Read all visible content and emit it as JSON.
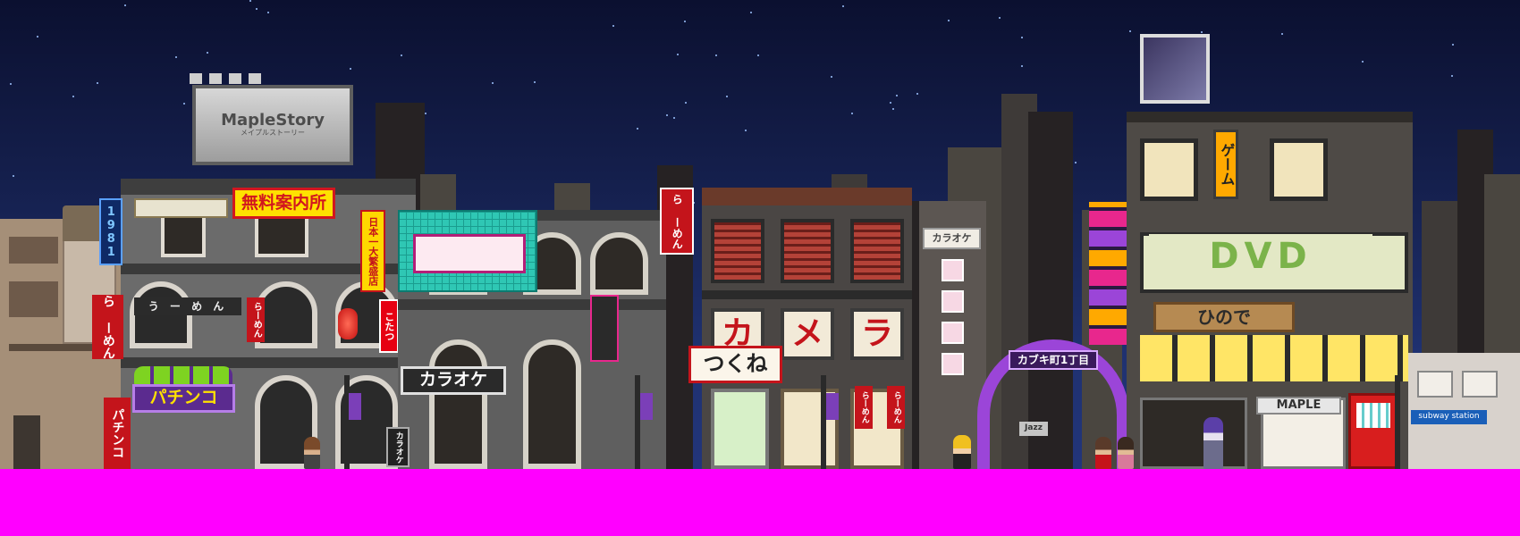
{
  "scene": {
    "name": "night-city-street",
    "colors": {
      "sky_top": "#0b1030",
      "sky_bottom": "#22357a",
      "ground": "#ff00ff",
      "neon_pink": "#e8278d",
      "neon_purple": "#9b45d8",
      "neon_teal": "#2fc7b4",
      "sign_yellow": "#ffe100",
      "sign_red": "#d2161e"
    }
  },
  "signs": {
    "maplestory_billboard": "MapleStory",
    "maplestory_sub": "メイプルストーリー",
    "year_1981": "1981",
    "muryou": "無料案内所",
    "nihon": "日本一大繁盛店",
    "ramen_vertical_left": "ら ーめん",
    "ramen_horizontal": "う ー め ん",
    "ramen_red_left": "らーめん",
    "ramen_red_mid": "こたつ",
    "pachinko": "パチンコ",
    "pachinko_vertical": "パチンコ",
    "karaoke_main": "カラオケ",
    "karaoke_small": "カラオケ",
    "karaoke_vertical": "カラオケ",
    "ramen_bowl_sign": "ら ーめん",
    "tsukune": "つくね",
    "kameraa_1": "カ",
    "kameraa_2": "メ",
    "kameraa_3": "ラ",
    "ramen_pair_1": "らーめん",
    "ramen_pair_2": "らーめん",
    "kabuki_arch": "カブキ町1丁目",
    "game": "ゲーム",
    "dvd": "DVD",
    "hinode": "ひので",
    "maple_shop": "MAPLE",
    "subway": "subway station",
    "jazz": "Jazz"
  }
}
